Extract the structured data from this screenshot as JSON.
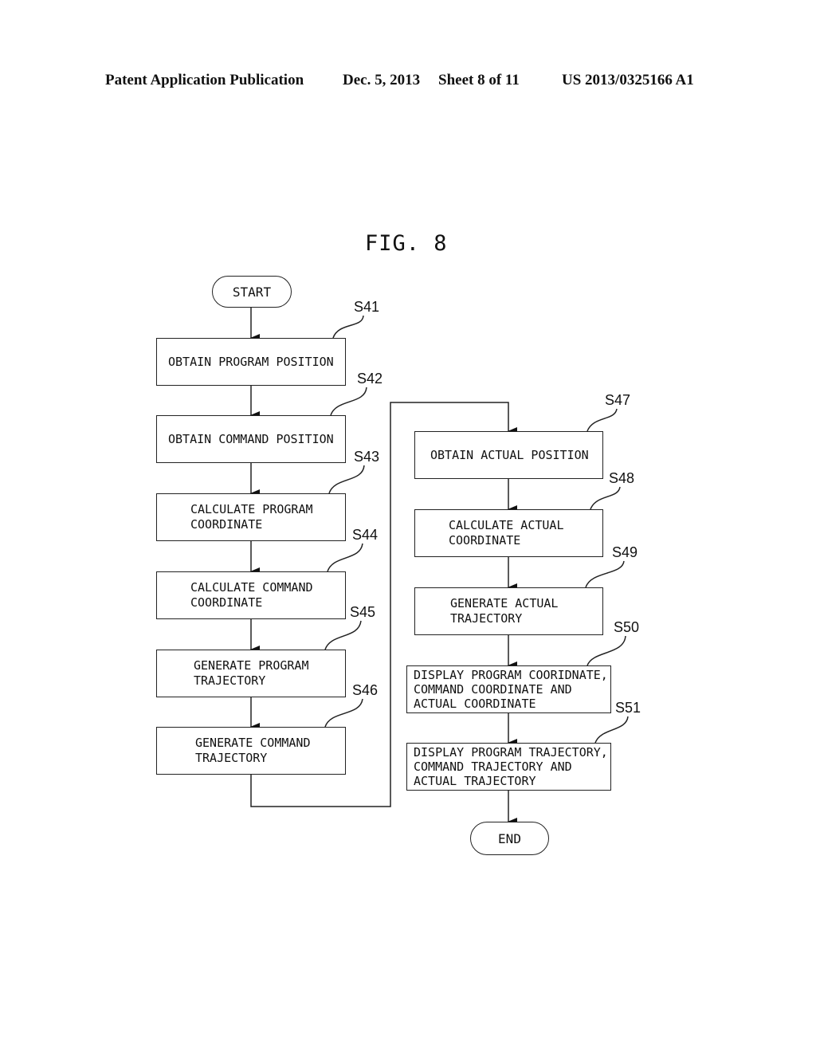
{
  "header": {
    "publication": "Patent Application Publication",
    "date": "Dec. 5, 2013",
    "sheet": "Sheet 8 of 11",
    "number": "US 2013/0325166 A1"
  },
  "figure": {
    "title": "FIG. 8",
    "start": "START",
    "end": "END",
    "steps": [
      {
        "id": "S41",
        "lines": [
          "OBTAIN PROGRAM POSITION"
        ]
      },
      {
        "id": "S42",
        "lines": [
          "OBTAIN COMMAND POSITION"
        ]
      },
      {
        "id": "S43",
        "lines": [
          "CALCULATE PROGRAM",
          "COORDINATE"
        ]
      },
      {
        "id": "S44",
        "lines": [
          "CALCULATE COMMAND",
          "COORDINATE"
        ]
      },
      {
        "id": "S45",
        "lines": [
          "GENERATE PROGRAM",
          "TRAJECTORY"
        ]
      },
      {
        "id": "S46",
        "lines": [
          "GENERATE COMMAND",
          "TRAJECTORY"
        ]
      },
      {
        "id": "S47",
        "lines": [
          "OBTAIN ACTUAL POSITION"
        ]
      },
      {
        "id": "S48",
        "lines": [
          "CALCULATE ACTUAL",
          "COORDINATE"
        ]
      },
      {
        "id": "S49",
        "lines": [
          "GENERATE ACTUAL",
          "TRAJECTORY"
        ]
      },
      {
        "id": "S50",
        "lines": [
          "DISPLAY PROGRAM COORIDNATE,",
          "COMMAND COORDINATE AND",
          "ACTUAL COORDINATE"
        ]
      },
      {
        "id": "S51",
        "lines": [
          "DISPLAY PROGRAM TRAJECTORY,",
          "COMMAND TRAJECTORY AND",
          "ACTUAL TRAJECTORY"
        ]
      }
    ]
  }
}
